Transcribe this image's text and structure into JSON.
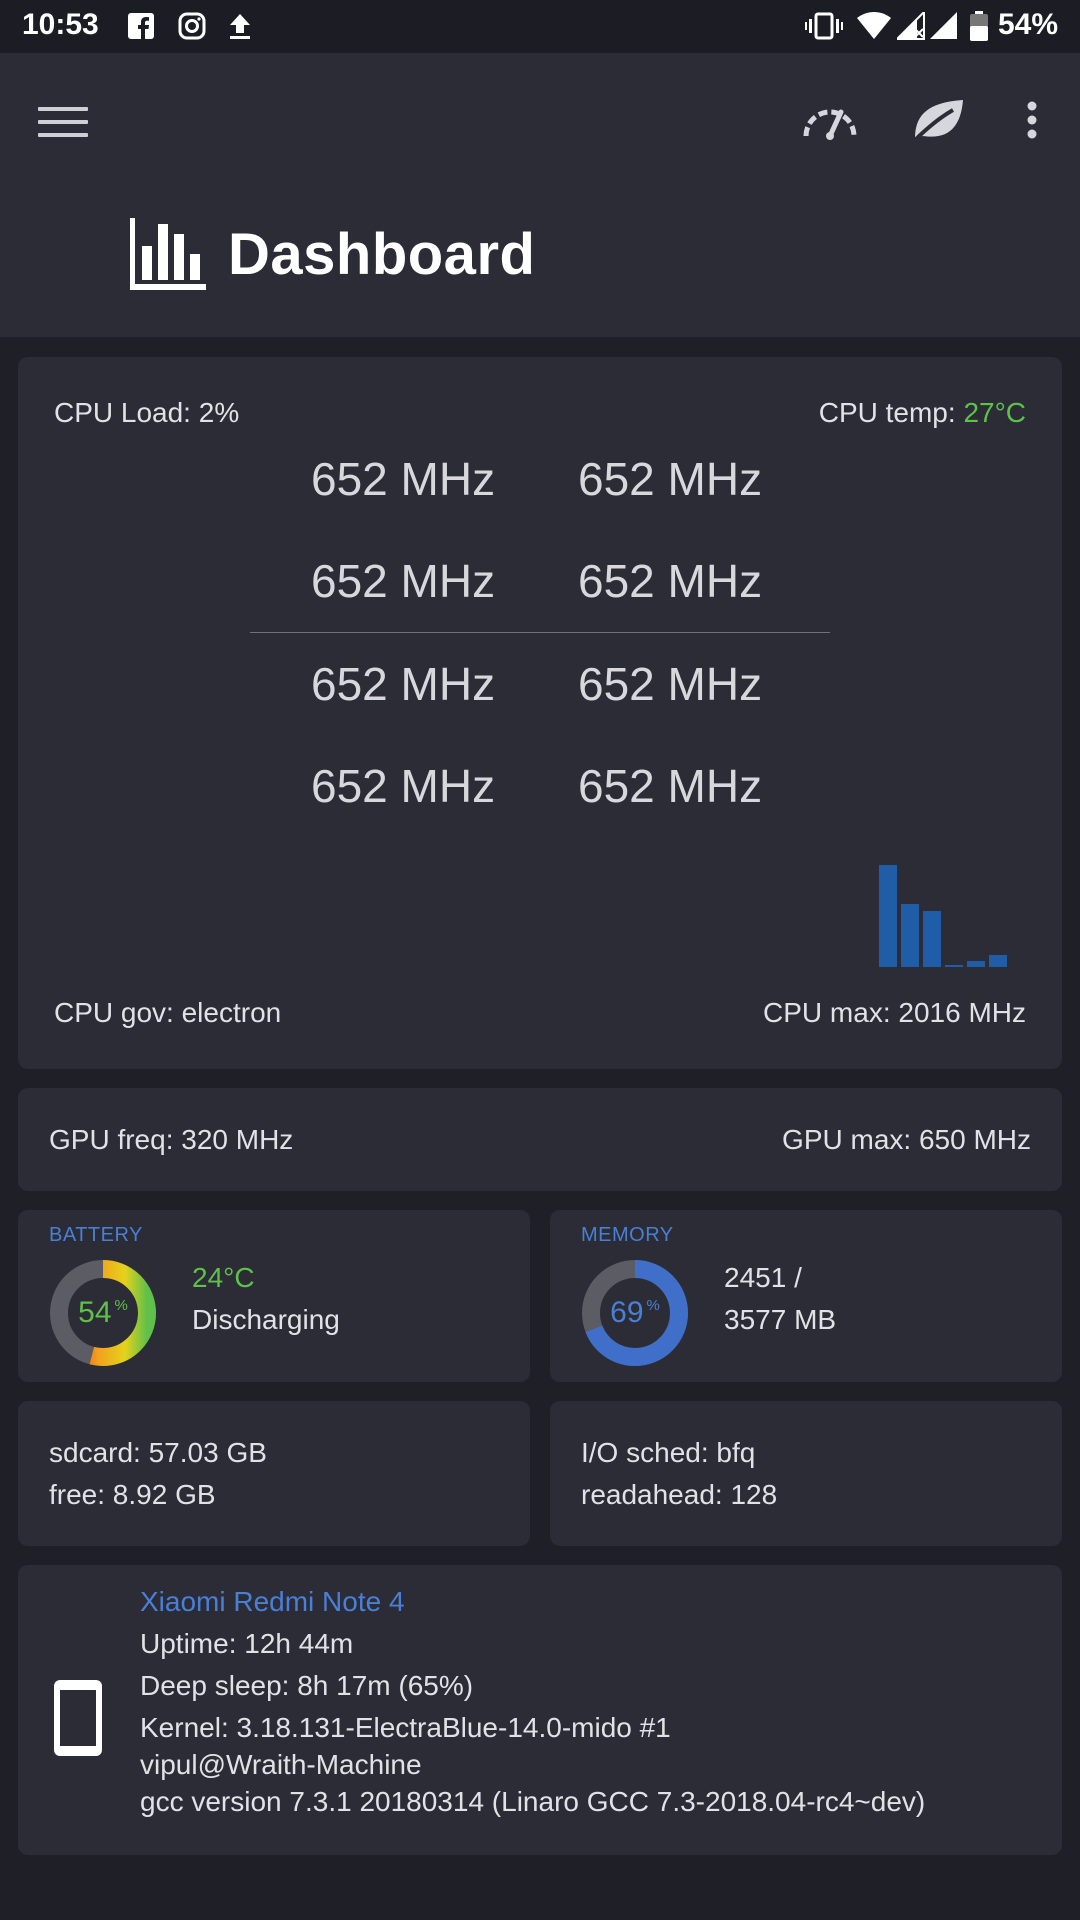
{
  "status_bar": {
    "time": "10:53",
    "battery": "54%"
  },
  "app_bar": {
    "title": "Dashboard"
  },
  "cpu": {
    "load": "CPU Load: 2%",
    "temp_label": "CPU temp: ",
    "temp_value": "27°C",
    "freqs": [
      "652 MHz",
      "652 MHz",
      "652 MHz",
      "652 MHz",
      "652 MHz",
      "652 MHz",
      "652 MHz",
      "652 MHz"
    ],
    "governor": "CPU gov: electron",
    "max": "CPU max: 2016 MHz",
    "histogram": [
      1.0,
      0.62,
      0.55,
      0.02,
      0.06,
      0.12
    ]
  },
  "gpu": {
    "freq": "GPU freq: 320 MHz",
    "max": "GPU max: 650 MHz"
  },
  "battery": {
    "title": "BATTERY",
    "percent": "54",
    "unit": "%",
    "level": 0.54,
    "temp": "24°C",
    "state": "Discharging"
  },
  "memory": {
    "title": "MEMORY",
    "percent": "69",
    "unit": "%",
    "level": 0.69,
    "used": "2451 /",
    "total": "3577 MB"
  },
  "storage": {
    "sdcard": "sdcard: 57.03 GB",
    "free": "free: 8.92 GB"
  },
  "io": {
    "sched": "I/O sched: bfq",
    "readahead": "readahead: 128"
  },
  "device": {
    "name": "Xiaomi Redmi Note 4",
    "uptime": "Uptime: 12h 44m",
    "deep_sleep": "Deep sleep: 8h 17m  (65%)",
    "kernel": "Kernel: 3.18.131-ElectraBlue-14.0-mido #1",
    "builder": "vipul@Wraith-Machine",
    "gcc": "gcc version 7.3.1 20180314 (Linaro GCC 7.3-2018.04-rc4~dev)"
  },
  "colors": {
    "accent": "#4a7fd6",
    "green": "#5fc04a",
    "bar": "#1f5ea6",
    "card": "#2b2c35",
    "background": "#1f2027"
  },
  "icons": {
    "menu": "menu-icon",
    "speed": "speedometer-icon",
    "leaf": "leaf-icon",
    "more": "more-vert-icon",
    "dashboard": "bar-chart-icon",
    "phone": "phone-icon"
  }
}
